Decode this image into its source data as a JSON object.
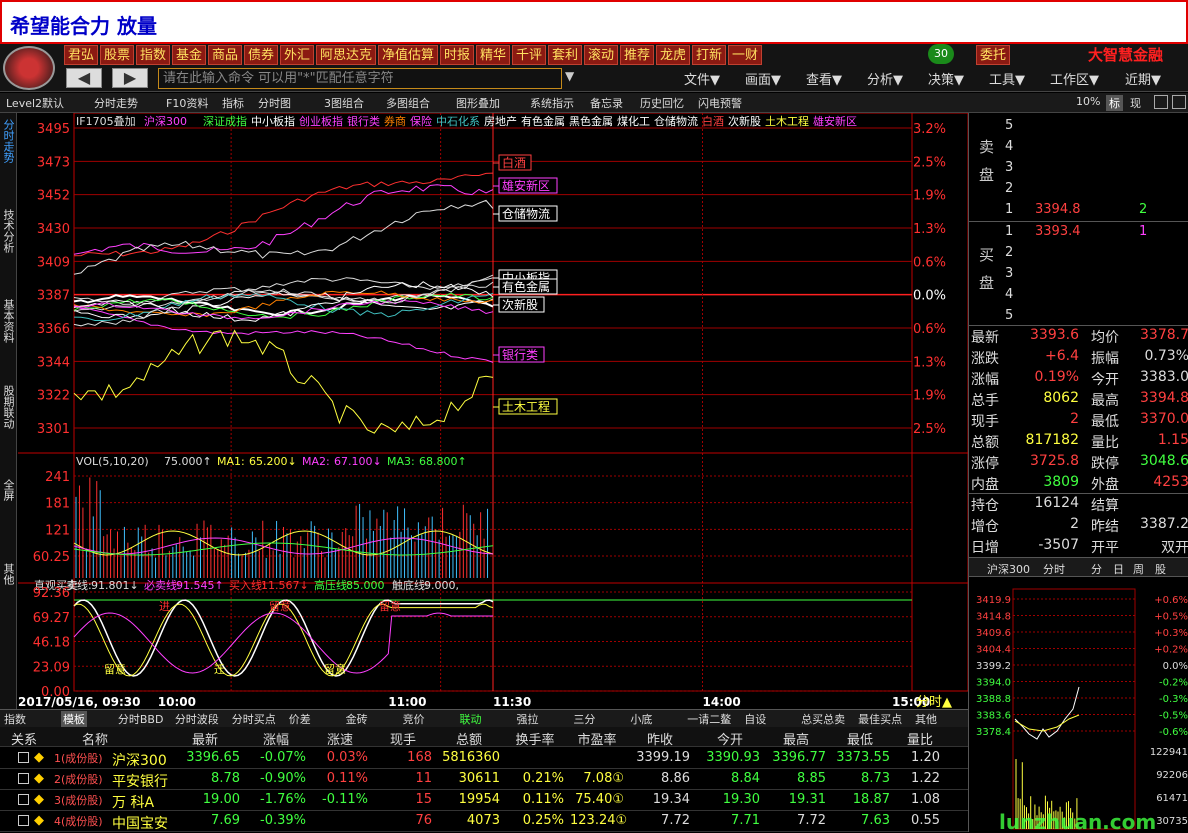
{
  "title": "希望能合力 放量",
  "nav": [
    "君弘",
    "股票",
    "指数",
    "基金",
    "商品",
    "债券",
    "外汇",
    "阿思达克",
    "净值估算",
    "时报",
    "精华",
    "千评",
    "套利",
    "滚动",
    "推荐",
    "龙虎",
    "打新",
    "一财",
    "委托"
  ],
  "badge": "30",
  "brand": "大智慧金融",
  "cmd_placeholder": "请在此输入命令  可以用\"*\"匹配任意字符",
  "menus": [
    "文件▼",
    "画面▼",
    "查看▼",
    "分析▼",
    "决策▼",
    "工具▼",
    "工作区▼",
    "近期▼"
  ],
  "toolbar2": [
    "Level2默认",
    "分时走势",
    "F10资料",
    "指标",
    "分时图",
    "3图组合",
    "多图组合",
    "图形叠加",
    "系统指示",
    "备忘录",
    "历史回忆",
    "闪电预警"
  ],
  "toolbar2_right": [
    "10%",
    "标",
    "现"
  ],
  "sidebar": [
    "分时走势",
    "技术分析",
    "基本资料",
    "股期联动",
    "全屏",
    "其他"
  ],
  "chart": {
    "legend_prefix": "IF1705叠加",
    "legend": [
      {
        "t": "沪深300",
        "c": "#ff40ff"
      },
      {
        "t": "深证成指",
        "c": "#40ff40"
      },
      {
        "t": "中小板指",
        "c": "#ffffff"
      },
      {
        "t": "创业板指",
        "c": "#ff40ff"
      },
      {
        "t": "银行类",
        "c": "#ff40ff"
      },
      {
        "t": "券商",
        "c": "#ff8000"
      },
      {
        "t": "保险",
        "c": "#ff40ff"
      },
      {
        "t": "中石化系",
        "c": "#40c0c0"
      },
      {
        "t": "房地产",
        "c": "#ffffff"
      },
      {
        "t": "有色金属",
        "c": "#ffffff"
      },
      {
        "t": "黑色金属",
        "c": "#ffffff"
      },
      {
        "t": "煤化工",
        "c": "#ffffff"
      },
      {
        "t": "仓储物流",
        "c": "#ffffff"
      },
      {
        "t": "白酒",
        "c": "#ff4040"
      },
      {
        "t": "次新股",
        "c": "#ffffff"
      },
      {
        "t": "土木工程",
        "c": "#ffff40"
      },
      {
        "t": "雄安新区",
        "c": "#ff40ff"
      }
    ],
    "price_ticks": [
      "3495",
      "3473",
      "3452",
      "3430",
      "3409",
      "3387",
      "3366",
      "3344",
      "3322",
      "3301"
    ],
    "pct_ticks": [
      "3.2%",
      "2.5%",
      "1.9%",
      "1.3%",
      "0.6%",
      "0.0%",
      "0.6%",
      "1.3%",
      "1.9%",
      "2.5%"
    ],
    "labels": [
      {
        "t": "白酒",
        "c": "#ff4040"
      },
      {
        "t": "雄安新区",
        "c": "#ff40ff"
      },
      {
        "t": "仓储物流",
        "c": "#ffffff"
      },
      {
        "t": "中小板指",
        "c": "#ffffff"
      },
      {
        "t": "有色金属",
        "c": "#ffffff"
      },
      {
        "t": "次新股",
        "c": "#ffffff"
      },
      {
        "t": "银行类",
        "c": "#ff40ff"
      },
      {
        "t": "土木工程",
        "c": "#ffff40"
      }
    ],
    "vol_legend": [
      "VOL(5,10,20)",
      "75.000↑",
      "MA1:",
      "65.200↓",
      "MA2:",
      "67.100↓",
      "MA3:",
      "68.800↑"
    ],
    "vol_ticks": [
      "241",
      "181",
      "121",
      "60.25"
    ],
    "ind_legend": [
      "直观买卖",
      "卖线:",
      "91.801↓",
      "必卖线:",
      "91.545↑",
      "买入线:",
      "11.567↓",
      "高压线:",
      "85.000",
      "触底线:",
      "9.000,"
    ],
    "ind_ticks": [
      "92.36",
      "69.27",
      "46.18",
      "23.09",
      "0.00"
    ],
    "time_labels": [
      "2017/05/16, 09:30",
      "10:00",
      "11:00",
      "11:30",
      "14:00",
      "15:00"
    ],
    "fenshi": "分时▲",
    "sig_labels": [
      "留意",
      "进",
      "迁",
      "留意",
      "留意",
      "留意"
    ]
  },
  "bottom_tabs": [
    "指数",
    "模板",
    "分时BBD",
    "分时波段",
    "分时买点",
    "价差",
    "金砖",
    "竞价",
    "联动",
    "强拉",
    "三分",
    "小底",
    "一请二鳌",
    "自设",
    "总买总卖",
    "最佳买点",
    "其他"
  ],
  "table": {
    "headers": [
      "关系",
      "名称",
      "最新",
      "涨幅",
      "涨速",
      "现手",
      "总额",
      "换手率",
      "市盈率",
      "昨收",
      "今开",
      "最高",
      "最低",
      "量比"
    ],
    "rows": [
      {
        "rel": "1(成份股)",
        "name": "沪深300",
        "last": "3396.65",
        "chg": "-0.07%",
        "spd": "0.03%",
        "hand": "168",
        "amt": "5816360",
        "turn": "",
        "pe": "",
        "prev": "3399.19",
        "open": "3390.93",
        "high": "3396.77",
        "low": "3373.55",
        "vr": "1.20"
      },
      {
        "rel": "2(成份股)",
        "name": "平安银行",
        "last": "8.78",
        "chg": "-0.90%",
        "spd": "0.11%",
        "hand": "11",
        "amt": "30611",
        "turn": "0.21%",
        "pe": "7.08①",
        "prev": "8.86",
        "open": "8.84",
        "high": "8.85",
        "low": "8.73",
        "vr": "1.22"
      },
      {
        "rel": "3(成份股)",
        "name": "万 科A",
        "last": "19.00",
        "chg": "-1.76%",
        "spd": "-0.11%",
        "hand": "15",
        "amt": "19954",
        "turn": "0.11%",
        "pe": "75.40①",
        "prev": "19.34",
        "open": "19.30",
        "high": "19.31",
        "low": "18.87",
        "vr": "1.08"
      },
      {
        "rel": "4(成份股)",
        "name": "中国宝安",
        "last": "7.69",
        "chg": "-0.39%",
        "spd": "",
        "hand": "76",
        "amt": "4073",
        "turn": "0.25%",
        "pe": "123.24①",
        "prev": "7.72",
        "open": "7.71",
        "high": "7.72",
        "low": "7.63",
        "vr": "0.55"
      }
    ]
  },
  "right": {
    "sell_label": "卖盘",
    "buy_label": "买盘",
    "sell": [
      {
        "n": "5",
        "p": "",
        "v": ""
      },
      {
        "n": "4",
        "p": "",
        "v": ""
      },
      {
        "n": "3",
        "p": "",
        "v": ""
      },
      {
        "n": "2",
        "p": "",
        "v": ""
      },
      {
        "n": "1",
        "p": "3394.8",
        "v": "2"
      }
    ],
    "buy": [
      {
        "n": "1",
        "p": "3393.4",
        "v": "1"
      },
      {
        "n": "2",
        "p": "",
        "v": ""
      },
      {
        "n": "3",
        "p": "",
        "v": ""
      },
      {
        "n": "4",
        "p": "",
        "v": ""
      },
      {
        "n": "5",
        "p": "",
        "v": ""
      }
    ],
    "stats": [
      {
        "l1": "最新",
        "v1": "3393.6",
        "l2": "均价",
        "v2": "3378.7"
      },
      {
        "l1": "涨跌",
        "v1": "+6.4",
        "l2": "振幅",
        "v2": "0.73%"
      },
      {
        "l1": "涨幅",
        "v1": "0.19%",
        "l2": "今开",
        "v2": "3383.0"
      },
      {
        "l1": "总手",
        "v1": "8062",
        "l2": "最高",
        "v2": "3394.8"
      },
      {
        "l1": "现手",
        "v1": "2",
        "l2": "最低",
        "v2": "3370.0"
      },
      {
        "l1": "总额",
        "v1": "817182",
        "l2": "量比",
        "v2": "1.15"
      },
      {
        "l1": "涨停",
        "v1": "3725.8",
        "l2": "跌停",
        "v2": "3048.6"
      },
      {
        "l1": "内盘",
        "v1": "3809",
        "l2": "外盘",
        "v2": "4253"
      }
    ],
    "stats2": [
      {
        "l1": "持仓",
        "v1": "16124",
        "l2": "结算",
        "v2": ""
      },
      {
        "l1": "增仓",
        "v1": "2",
        "l2": "昨结",
        "v2": "3387.2"
      },
      {
        "l1": "日增",
        "v1": "-3507",
        "l2": "开平",
        "v2": "双开"
      }
    ],
    "mini_tabs": [
      "沪深300",
      "分时",
      "分",
      "日",
      "周",
      "股"
    ],
    "mini_price": [
      "3419.9",
      "3414.8",
      "3409.6",
      "3404.4",
      "3399.2",
      "3394.0",
      "3388.8",
      "3383.6",
      "3378.4"
    ],
    "mini_pct": [
      "+0.6%",
      "+0.5%",
      "+0.3%",
      "+0.2%",
      "0.0%",
      "-0.2%",
      "-0.3%",
      "-0.5%",
      "-0.6%"
    ],
    "mini_vol": [
      "122941",
      "92206",
      "61471",
      "30735"
    ],
    "watermark": "lunzhuan.com"
  }
}
